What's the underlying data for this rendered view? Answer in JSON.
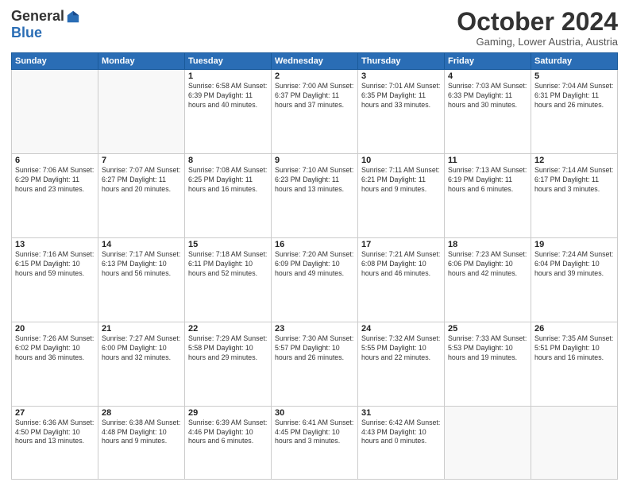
{
  "logo": {
    "general": "General",
    "blue": "Blue"
  },
  "title": "October 2024",
  "subtitle": "Gaming, Lower Austria, Austria",
  "days_header": [
    "Sunday",
    "Monday",
    "Tuesday",
    "Wednesday",
    "Thursday",
    "Friday",
    "Saturday"
  ],
  "weeks": [
    [
      {
        "day": "",
        "info": ""
      },
      {
        "day": "",
        "info": ""
      },
      {
        "day": "1",
        "info": "Sunrise: 6:58 AM\nSunset: 6:39 PM\nDaylight: 11 hours\nand 40 minutes."
      },
      {
        "day": "2",
        "info": "Sunrise: 7:00 AM\nSunset: 6:37 PM\nDaylight: 11 hours\nand 37 minutes."
      },
      {
        "day": "3",
        "info": "Sunrise: 7:01 AM\nSunset: 6:35 PM\nDaylight: 11 hours\nand 33 minutes."
      },
      {
        "day": "4",
        "info": "Sunrise: 7:03 AM\nSunset: 6:33 PM\nDaylight: 11 hours\nand 30 minutes."
      },
      {
        "day": "5",
        "info": "Sunrise: 7:04 AM\nSunset: 6:31 PM\nDaylight: 11 hours\nand 26 minutes."
      }
    ],
    [
      {
        "day": "6",
        "info": "Sunrise: 7:06 AM\nSunset: 6:29 PM\nDaylight: 11 hours\nand 23 minutes."
      },
      {
        "day": "7",
        "info": "Sunrise: 7:07 AM\nSunset: 6:27 PM\nDaylight: 11 hours\nand 20 minutes."
      },
      {
        "day": "8",
        "info": "Sunrise: 7:08 AM\nSunset: 6:25 PM\nDaylight: 11 hours\nand 16 minutes."
      },
      {
        "day": "9",
        "info": "Sunrise: 7:10 AM\nSunset: 6:23 PM\nDaylight: 11 hours\nand 13 minutes."
      },
      {
        "day": "10",
        "info": "Sunrise: 7:11 AM\nSunset: 6:21 PM\nDaylight: 11 hours\nand 9 minutes."
      },
      {
        "day": "11",
        "info": "Sunrise: 7:13 AM\nSunset: 6:19 PM\nDaylight: 11 hours\nand 6 minutes."
      },
      {
        "day": "12",
        "info": "Sunrise: 7:14 AM\nSunset: 6:17 PM\nDaylight: 11 hours\nand 3 minutes."
      }
    ],
    [
      {
        "day": "13",
        "info": "Sunrise: 7:16 AM\nSunset: 6:15 PM\nDaylight: 10 hours\nand 59 minutes."
      },
      {
        "day": "14",
        "info": "Sunrise: 7:17 AM\nSunset: 6:13 PM\nDaylight: 10 hours\nand 56 minutes."
      },
      {
        "day": "15",
        "info": "Sunrise: 7:18 AM\nSunset: 6:11 PM\nDaylight: 10 hours\nand 52 minutes."
      },
      {
        "day": "16",
        "info": "Sunrise: 7:20 AM\nSunset: 6:09 PM\nDaylight: 10 hours\nand 49 minutes."
      },
      {
        "day": "17",
        "info": "Sunrise: 7:21 AM\nSunset: 6:08 PM\nDaylight: 10 hours\nand 46 minutes."
      },
      {
        "day": "18",
        "info": "Sunrise: 7:23 AM\nSunset: 6:06 PM\nDaylight: 10 hours\nand 42 minutes."
      },
      {
        "day": "19",
        "info": "Sunrise: 7:24 AM\nSunset: 6:04 PM\nDaylight: 10 hours\nand 39 minutes."
      }
    ],
    [
      {
        "day": "20",
        "info": "Sunrise: 7:26 AM\nSunset: 6:02 PM\nDaylight: 10 hours\nand 36 minutes."
      },
      {
        "day": "21",
        "info": "Sunrise: 7:27 AM\nSunset: 6:00 PM\nDaylight: 10 hours\nand 32 minutes."
      },
      {
        "day": "22",
        "info": "Sunrise: 7:29 AM\nSunset: 5:58 PM\nDaylight: 10 hours\nand 29 minutes."
      },
      {
        "day": "23",
        "info": "Sunrise: 7:30 AM\nSunset: 5:57 PM\nDaylight: 10 hours\nand 26 minutes."
      },
      {
        "day": "24",
        "info": "Sunrise: 7:32 AM\nSunset: 5:55 PM\nDaylight: 10 hours\nand 22 minutes."
      },
      {
        "day": "25",
        "info": "Sunrise: 7:33 AM\nSunset: 5:53 PM\nDaylight: 10 hours\nand 19 minutes."
      },
      {
        "day": "26",
        "info": "Sunrise: 7:35 AM\nSunset: 5:51 PM\nDaylight: 10 hours\nand 16 minutes."
      }
    ],
    [
      {
        "day": "27",
        "info": "Sunrise: 6:36 AM\nSunset: 4:50 PM\nDaylight: 10 hours\nand 13 minutes."
      },
      {
        "day": "28",
        "info": "Sunrise: 6:38 AM\nSunset: 4:48 PM\nDaylight: 10 hours\nand 9 minutes."
      },
      {
        "day": "29",
        "info": "Sunrise: 6:39 AM\nSunset: 4:46 PM\nDaylight: 10 hours\nand 6 minutes."
      },
      {
        "day": "30",
        "info": "Sunrise: 6:41 AM\nSunset: 4:45 PM\nDaylight: 10 hours\nand 3 minutes."
      },
      {
        "day": "31",
        "info": "Sunrise: 6:42 AM\nSunset: 4:43 PM\nDaylight: 10 hours\nand 0 minutes."
      },
      {
        "day": "",
        "info": ""
      },
      {
        "day": "",
        "info": ""
      }
    ]
  ]
}
